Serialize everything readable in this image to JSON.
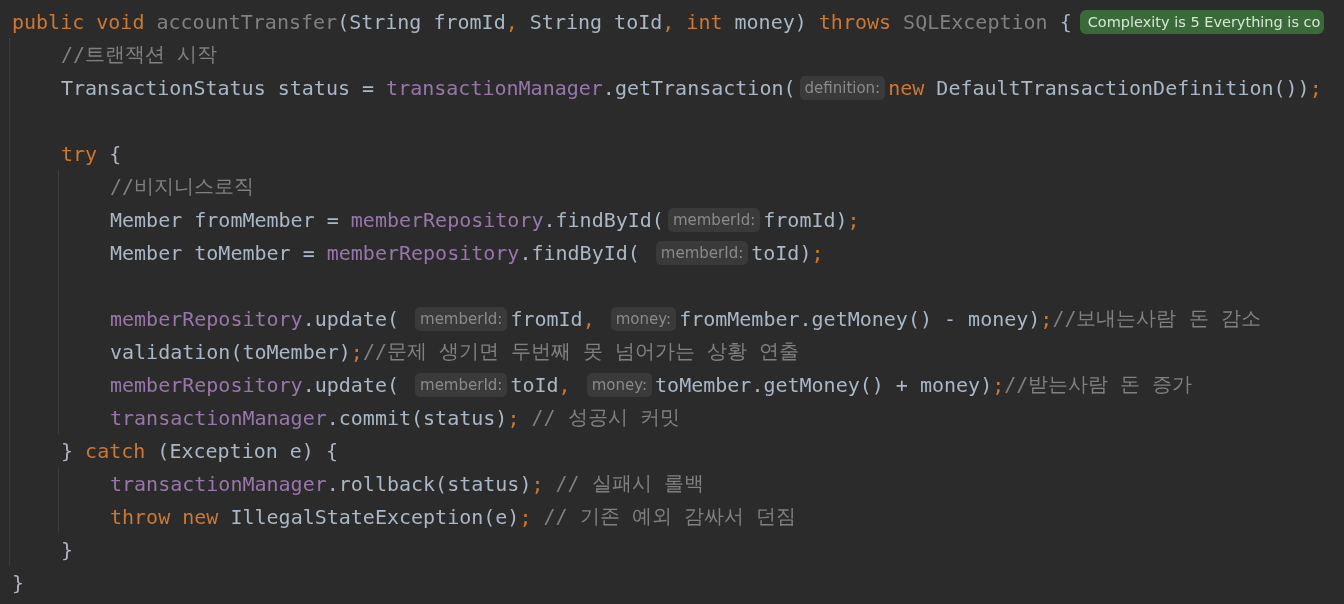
{
  "editor": {
    "lines": [
      {
        "kind": "code",
        "tokens": [
          {
            "kind": "keyword",
            "text": "public void "
          },
          {
            "kind": "unused",
            "text": "accountTransfer"
          },
          {
            "kind": "plain",
            "text": "(String fromId"
          },
          {
            "kind": "punct",
            "text": ", "
          },
          {
            "kind": "plain",
            "text": "String toId"
          },
          {
            "kind": "punct",
            "text": ", "
          },
          {
            "kind": "keyword",
            "text": "int "
          },
          {
            "kind": "plain",
            "text": "money) "
          },
          {
            "kind": "keyword",
            "text": "throws "
          },
          {
            "kind": "unused",
            "text": "SQLException "
          },
          {
            "kind": "plain",
            "text": "{"
          },
          {
            "kind": "badge",
            "text": "Complexity is 5 Everything is co"
          }
        ],
        "children": [
          {
            "kind": "code",
            "tokens": [
              {
                "kind": "comment",
                "text": "//트랜잭션 시작"
              }
            ]
          },
          {
            "kind": "code",
            "tokens": [
              {
                "kind": "plain",
                "text": "TransactionStatus status = "
              },
              {
                "kind": "field",
                "text": "transactionManager"
              },
              {
                "kind": "plain",
                "text": ".getTransaction("
              },
              {
                "kind": "hint",
                "text": "definition:"
              },
              {
                "kind": "keyword",
                "text": "new "
              },
              {
                "kind": "plain",
                "text": "DefaultTransactionDefinition())"
              },
              {
                "kind": "punct",
                "text": ";"
              }
            ]
          },
          {
            "kind": "blank"
          },
          {
            "kind": "code",
            "tokens": [
              {
                "kind": "keyword",
                "text": "try "
              },
              {
                "kind": "plain",
                "text": "{"
              }
            ],
            "children": [
              {
                "kind": "code",
                "tokens": [
                  {
                    "kind": "comment",
                    "text": "//비지니스로직"
                  }
                ]
              },
              {
                "kind": "code",
                "tokens": [
                  {
                    "kind": "plain",
                    "text": "Member fromMember = "
                  },
                  {
                    "kind": "field",
                    "text": "memberRepository"
                  },
                  {
                    "kind": "plain",
                    "text": ".findById("
                  },
                  {
                    "kind": "hint",
                    "text": "memberId:"
                  },
                  {
                    "kind": "plain",
                    "text": "fromId)"
                  },
                  {
                    "kind": "punct",
                    "text": ";"
                  }
                ]
              },
              {
                "kind": "code",
                "tokens": [
                  {
                    "kind": "plain",
                    "text": "Member toMember = "
                  },
                  {
                    "kind": "field",
                    "text": "memberRepository"
                  },
                  {
                    "kind": "plain",
                    "text": ".findById( "
                  },
                  {
                    "kind": "hint",
                    "text": "memberId:"
                  },
                  {
                    "kind": "plain",
                    "text": "toId)"
                  },
                  {
                    "kind": "punct",
                    "text": ";"
                  }
                ]
              },
              {
                "kind": "blank"
              },
              {
                "kind": "code",
                "tokens": [
                  {
                    "kind": "field",
                    "text": "memberRepository"
                  },
                  {
                    "kind": "plain",
                    "text": ".update( "
                  },
                  {
                    "kind": "hint",
                    "text": "memberId:"
                  },
                  {
                    "kind": "plain",
                    "text": "fromId"
                  },
                  {
                    "kind": "punct",
                    "text": ", "
                  },
                  {
                    "kind": "hint",
                    "text": "money:"
                  },
                  {
                    "kind": "plain",
                    "text": "fromMember.getMoney() - money)"
                  },
                  {
                    "kind": "punct",
                    "text": ";"
                  },
                  {
                    "kind": "comment",
                    "text": "//보내는사람 돈 감소"
                  }
                ]
              },
              {
                "kind": "code",
                "tokens": [
                  {
                    "kind": "plain",
                    "text": "validation(toMember)"
                  },
                  {
                    "kind": "punct",
                    "text": ";"
                  },
                  {
                    "kind": "comment",
                    "text": "//문제 생기면 두번째 못 넘어가는 상황 연출"
                  }
                ]
              },
              {
                "kind": "code",
                "tokens": [
                  {
                    "kind": "field",
                    "text": "memberRepository"
                  },
                  {
                    "kind": "plain",
                    "text": ".update( "
                  },
                  {
                    "kind": "hint",
                    "text": "memberId:"
                  },
                  {
                    "kind": "plain",
                    "text": "toId"
                  },
                  {
                    "kind": "punct",
                    "text": ", "
                  },
                  {
                    "kind": "hint",
                    "text": "money:"
                  },
                  {
                    "kind": "plain",
                    "text": "toMember.getMoney() + money)"
                  },
                  {
                    "kind": "punct",
                    "text": ";"
                  },
                  {
                    "kind": "comment",
                    "text": "//받는사람 돈 증가"
                  }
                ]
              },
              {
                "kind": "code",
                "tokens": [
                  {
                    "kind": "field",
                    "text": "transactionManager"
                  },
                  {
                    "kind": "plain",
                    "text": ".commit(status)"
                  },
                  {
                    "kind": "punct",
                    "text": "; "
                  },
                  {
                    "kind": "comment",
                    "text": "// 성공시 커밋"
                  }
                ]
              }
            ]
          },
          {
            "kind": "code",
            "tokens": [
              {
                "kind": "plain",
                "text": "} "
              },
              {
                "kind": "keyword",
                "text": "catch "
              },
              {
                "kind": "plain",
                "text": "(Exception e) {"
              }
            ],
            "children": [
              {
                "kind": "code",
                "tokens": [
                  {
                    "kind": "field",
                    "text": "transactionManager"
                  },
                  {
                    "kind": "plain",
                    "text": ".rollback(status)"
                  },
                  {
                    "kind": "punct",
                    "text": "; "
                  },
                  {
                    "kind": "comment",
                    "text": "// 실패시 롤백"
                  }
                ]
              },
              {
                "kind": "code",
                "tokens": [
                  {
                    "kind": "keyword",
                    "text": "throw new "
                  },
                  {
                    "kind": "plain",
                    "text": "IllegalStateException(e)"
                  },
                  {
                    "kind": "punct",
                    "text": "; "
                  },
                  {
                    "kind": "comment",
                    "text": "// 기존 예외 감싸서 던짐"
                  }
                ]
              }
            ]
          },
          {
            "kind": "code",
            "tokens": [
              {
                "kind": "plain",
                "text": "}"
              }
            ]
          }
        ]
      },
      {
        "kind": "code",
        "tokens": [
          {
            "kind": "plain",
            "text": "}"
          }
        ]
      }
    ]
  }
}
